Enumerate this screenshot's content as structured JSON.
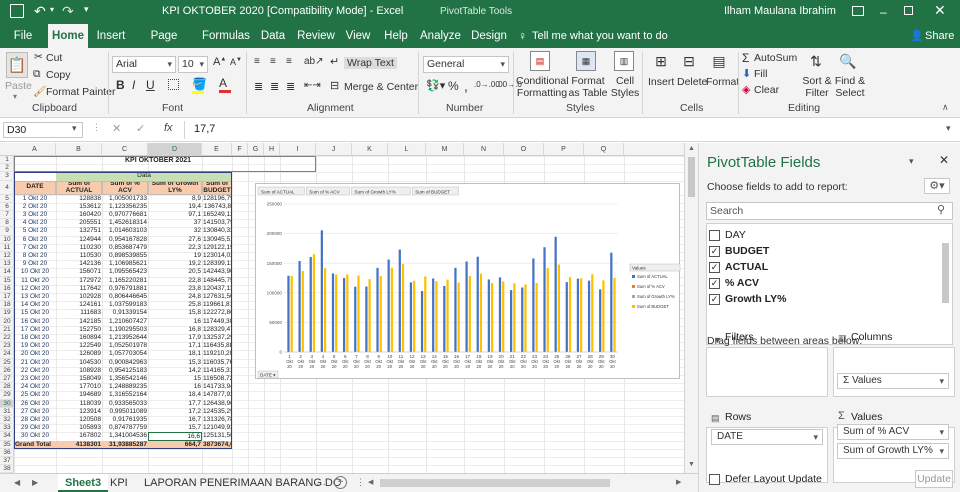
{
  "window": {
    "title": "KPI OKTOBER 2020  [Compatibility Mode]  -  Excel",
    "context_tool": "PivotTable Tools",
    "user": "Ilham Maulana Ibrahim"
  },
  "menu": {
    "tabs": [
      "File",
      "Home",
      "Insert",
      "Page Layout",
      "Formulas",
      "Data",
      "Review",
      "View",
      "Help",
      "Analyze",
      "Design"
    ],
    "tellme": "Tell me what you want to do",
    "share": "Share"
  },
  "ribbon": {
    "clipboard": {
      "label": "Clipboard",
      "paste": "Paste",
      "cut": "Cut",
      "copy": "Copy",
      "format_painter": "Format Painter"
    },
    "font": {
      "label": "Font",
      "name": "Arial",
      "size": "10"
    },
    "alignment": {
      "label": "Alignment",
      "wrap": "Wrap Text",
      "merge": "Merge & Center"
    },
    "number": {
      "label": "Number",
      "format": "General"
    },
    "styles": {
      "label": "Styles",
      "cond": "Conditional Formatting",
      "format_table": "Format as Table",
      "cell_styles": "Cell Styles"
    },
    "cells": {
      "label": "Cells",
      "insert": "Insert",
      "delete": "Delete",
      "format": "Format"
    },
    "editing": {
      "label": "Editing",
      "autosum": "AutoSum",
      "fill": "Fill",
      "clear": "Clear",
      "sort": "Sort & Filter",
      "find": "Find & Select"
    }
  },
  "formula_bar": {
    "name_box": "D30",
    "fx": "fx",
    "value": "17,7"
  },
  "sheet": {
    "columns": [
      "A",
      "B",
      "C",
      "D",
      "E",
      "F",
      "G",
      "H",
      "I",
      "J",
      "K",
      "L",
      "M",
      "N",
      "O",
      "P",
      "Q"
    ],
    "rows": [
      "1",
      "2",
      "3",
      "4",
      "5",
      "6",
      "7",
      "8",
      "9",
      "10",
      "11",
      "12",
      "13",
      "14",
      "15",
      "16",
      "17",
      "18",
      "19",
      "20",
      "21",
      "22",
      "23",
      "24",
      "25",
      "26",
      "27",
      "28",
      "29",
      "30",
      "31",
      "32",
      "33",
      "34",
      "35",
      "36",
      "37",
      "38",
      "39",
      "40"
    ],
    "title": "KPI OKTOBER 2021",
    "data_label": "Data",
    "headers": [
      "DATE",
      "Sum of ACTUAL",
      "Sum of % ACV",
      "Sum of Growth LY%",
      "Sum of BUDGET"
    ],
    "table": [
      [
        "1 Okt 20",
        "128838",
        "1,005001733",
        "8,9",
        "128196,794"
      ],
      [
        "2 Okt 20",
        "153612",
        "1,123356235",
        "19,4",
        "136743,8"
      ],
      [
        "3 Okt 20",
        "160420",
        "0,970776681",
        "97,1",
        "165249,128"
      ],
      [
        "4 Okt 20",
        "205551",
        "1,452618314",
        "37",
        "141503,792"
      ],
      [
        "5 Okt 20",
        "132751",
        "1,014603103",
        "32",
        "130840,325"
      ],
      [
        "6 Okt 20",
        "124944",
        "0,954167828",
        "27,6",
        "130945,518"
      ],
      [
        "7 Okt 20",
        "110230",
        "0,853687479",
        "22,3",
        "129122,194"
      ],
      [
        "8 Okt 20",
        "110530",
        "0,898539855",
        "19",
        "123014,02"
      ],
      [
        "9 Okt 20",
        "142136",
        "1,106985621",
        "19,2",
        "128399,138"
      ],
      [
        "10 Okt 20",
        "156071",
        "1,095565423",
        "20,5",
        "142443,901"
      ],
      [
        "11 Okt 20",
        "172972",
        "1,165220281",
        "22,8",
        "148445,751"
      ],
      [
        "12 Okt 20",
        "117642",
        "0,976791881",
        "23,8",
        "120437,119"
      ],
      [
        "13 Okt 20",
        "102928",
        "0,806446645",
        "24,8",
        "127631,506"
      ],
      [
        "14 Okt 20",
        "124161",
        "1,037599183",
        "25,8",
        "119661,814"
      ],
      [
        "15 Okt 20",
        "111683",
        "0,91339154",
        "15,8",
        "122272,864"
      ],
      [
        "16 Okt 20",
        "142185",
        "1,210607427",
        "16",
        "117449,304"
      ],
      [
        "17 Okt 20",
        "152750",
        "1,190295503",
        "16,8",
        "128329,478"
      ],
      [
        "18 Okt 20",
        "160894",
        "1,213952644",
        "17,9",
        "132537,295"
      ],
      [
        "19 Okt 20",
        "122549",
        "1,052501978",
        "17,1",
        "116435,885"
      ],
      [
        "20 Okt 20",
        "126089",
        "1,057703054",
        "18,1",
        "119210,207"
      ],
      [
        "21 Okt 20",
        "104530",
        "0,900842963",
        "15,3",
        "116035,762"
      ],
      [
        "22 Okt 20",
        "108928",
        "0,954125183",
        "14,2",
        "114165,313"
      ],
      [
        "23 Okt 20",
        "158049",
        "1,356542146",
        "15",
        "116508,728"
      ],
      [
        "24 Okt 20",
        "177010",
        "1,248889235",
        "16",
        "141733,946"
      ],
      [
        "25 Okt 20",
        "194689",
        "1,316552164",
        "18,4",
        "147877,923"
      ],
      [
        "26 Okt 20",
        "118039",
        "0,933565033",
        "17,7",
        "126438,969"
      ],
      [
        "27 Okt 20",
        "123914",
        "0,995011089",
        "17,2",
        "124535,296"
      ],
      [
        "28 Okt 20",
        "120508",
        "0,91761935",
        "16,7",
        "131326,786"
      ],
      [
        "29 Okt 20",
        "105893",
        "0,874787759",
        "15,7",
        "121049,933"
      ],
      [
        "30 Okt 20",
        "167802",
        "1,341004536",
        "16,6",
        "125131,568"
      ]
    ],
    "grand_total": [
      "Grand Total",
      "4138301",
      "31,93885287",
      "664,7",
      "3873674,06"
    ]
  },
  "chart_data": {
    "type": "bar",
    "title": "",
    "field_buttons": [
      "Sum of ACTUAL",
      "Sum of % ACV",
      "Sum of Growth LY%",
      "Sum of BUDGET"
    ],
    "axis_button": "DATE",
    "legend_title": "Values",
    "legend": [
      "Sum of ACTUAL",
      "Sum of % ACV",
      "Sum of Growth LY%",
      "Sum of BUDGET"
    ],
    "legend_position": "right",
    "colors": [
      "#4472c4",
      "#ed7d31",
      "#a5a5a5",
      "#ffc000"
    ],
    "ylim": [
      0,
      250000
    ],
    "yticks": [
      0,
      50000,
      100000,
      150000,
      200000,
      250000
    ],
    "ytick_labels": [
      "0",
      "50000",
      "100000",
      "150000",
      "200000",
      "250000"
    ],
    "grid": true,
    "categories": [
      "1",
      "2",
      "3",
      "4",
      "5",
      "6",
      "7",
      "8",
      "9",
      "10",
      "11",
      "12",
      "13",
      "14",
      "15",
      "16",
      "17",
      "18",
      "19",
      "20",
      "21",
      "22",
      "23",
      "24",
      "25",
      "26",
      "27",
      "28",
      "29",
      "30"
    ],
    "category_sub": [
      "Okt",
      "20"
    ],
    "series": [
      {
        "name": "Sum of ACTUAL",
        "values": [
          128838,
          153612,
          160420,
          205551,
          132751,
          124944,
          110230,
          110530,
          142136,
          156071,
          172972,
          117642,
          102928,
          124161,
          111683,
          142185,
          152750,
          160894,
          122549,
          126089,
          104530,
          108928,
          158049,
          177010,
          194689,
          118039,
          123914,
          120508,
          105893,
          167802
        ]
      },
      {
        "name": "Sum of BUDGET",
        "values": [
          128196.794,
          136743.8,
          165249.128,
          141503.792,
          130840.325,
          130945.518,
          129122.194,
          123014.02,
          128399.138,
          142443.901,
          148445.751,
          120437.119,
          127631.506,
          119661.814,
          122272.864,
          117449.304,
          128329.478,
          132537.295,
          116435.885,
          119210.207,
          116035.762,
          114165.313,
          116508.728,
          141733.946,
          147877.923,
          126438.969,
          124535.296,
          131326.786,
          121049.933,
          125131.568
        ]
      }
    ]
  },
  "sheet_tabs": {
    "active": "Sheet3",
    "tabs": [
      "Sheet3",
      "KPI",
      "LAPORAN PENERIMAAN BARANG DC"
    ]
  },
  "pivot_pane": {
    "title": "PivotTable Fields",
    "subtitle": "Choose fields to add to report:",
    "search_placeholder": "Search",
    "fields": [
      {
        "name": "DAY",
        "checked": false
      },
      {
        "name": "BUDGET",
        "checked": true
      },
      {
        "name": "ACTUAL",
        "checked": true
      },
      {
        "name": "% ACV",
        "checked": true
      },
      {
        "name": "Growth LY%",
        "checked": true
      }
    ],
    "drag_label": "Drag fields between areas below:",
    "filters": "Filters",
    "columns": "Columns",
    "rows": "Rows",
    "values": "Values",
    "columns_item": "Σ Values",
    "rows_item": "DATE",
    "values_items": [
      "Sum of % ACV",
      "Sum of Growth LY%"
    ],
    "defer": "Defer Layout Update",
    "update": "Update"
  }
}
